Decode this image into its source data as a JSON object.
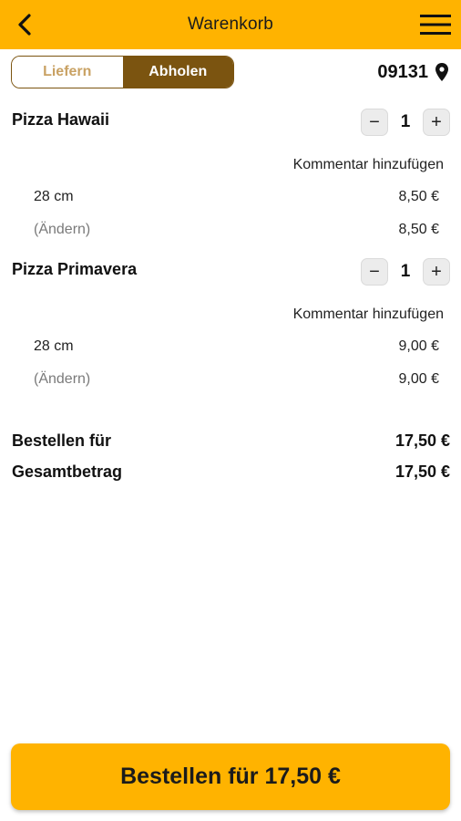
{
  "header": {
    "title": "Warenkorb",
    "back_icon": "chevron-left-icon",
    "menu_icon": "hamburger-menu-icon",
    "background": "#FFB300"
  },
  "toggle": {
    "options": [
      "Liefern",
      "Abholen"
    ],
    "selected": "Abholen",
    "active_color": "#7B5410"
  },
  "location": {
    "postal_code": "09131",
    "icon": "map-pin-icon"
  },
  "cart": {
    "items": [
      {
        "name": "Pizza Hawaii",
        "quantity": "1",
        "decrement": "−",
        "increment": "+",
        "comment_label": "Kommentar hinzufügen",
        "size": "28 cm",
        "size_price": "8,50 €",
        "change_label": "(Ändern)",
        "total": "8,50 €"
      },
      {
        "name": "Pizza Primavera",
        "quantity": "1",
        "decrement": "−",
        "increment": "+",
        "comment_label": "Kommentar hinzufügen",
        "size": "28 cm",
        "size_price": "9,00 €",
        "change_label": "(Ändern)",
        "total": "9,00 €"
      }
    ]
  },
  "summary": {
    "order_for_label": "Bestellen für",
    "order_for_value": "17,50 €",
    "total_label": "Gesamtbetrag",
    "total_value": "17,50 €"
  },
  "footer": {
    "order_button_label": "Bestellen für 17,50 €"
  }
}
